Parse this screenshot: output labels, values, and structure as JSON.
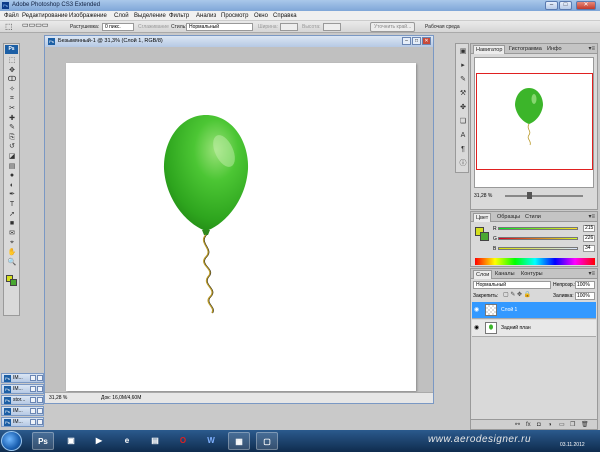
{
  "window": {
    "title": "Adobe Photoshop CS3 Extended",
    "min_glyph": "–",
    "max_glyph": "□",
    "close_glyph": "✕",
    "icon_label": "Ps"
  },
  "menu": [
    "Файл",
    "Редактирование",
    "Изображение",
    "Слой",
    "Выделение",
    "Фильтр",
    "Анализ",
    "Просмотр",
    "Окно",
    "Справка"
  ],
  "options_bar": {
    "feather_label": "Растушевка:",
    "feather_value": "0 пикс.",
    "antialias_label": "Сглаживание",
    "style_label": "Стиль:",
    "style_value": "Нормальный",
    "width_label": "Ширина:",
    "height_label": "Высота:",
    "refine_button": "Уточнить край...",
    "workspace_label": "Рабочая среда"
  },
  "toolbox": {
    "logo": "Ps",
    "tools": [
      "marquee-icon",
      "move-icon",
      "lasso-icon",
      "magic-wand-icon",
      "crop-icon",
      "slice-icon",
      "healing-icon",
      "brush-icon",
      "clone-stamp-icon",
      "history-brush-icon",
      "eraser-icon",
      "gradient-icon",
      "blur-icon",
      "dodge-icon",
      "pen-icon",
      "type-icon",
      "path-select-icon",
      "shape-icon",
      "notes-icon",
      "eyedropper-icon",
      "hand-icon",
      "zoom-icon"
    ],
    "glyphs": [
      "⬚",
      "✥",
      "ↀ",
      "✧",
      "⌗",
      "✂",
      "✚",
      "✎",
      "⎘",
      "↺",
      "◪",
      "▤",
      "●",
      "◐",
      "✒",
      "T",
      "➚",
      "■",
      "✉",
      "⌖",
      "✋",
      "🔍"
    ],
    "foreground_color": "#d4df1f",
    "background_color": "#4aa832"
  },
  "document": {
    "title": "Безымянный-1 @ 31,3% (Слой 1, RGB/8)",
    "zoom": "31,28 %",
    "doc_size": "Док: 16,0M/4,60M",
    "icon_label": "Ps"
  },
  "minimized_docs": [
    "IM...",
    "IM...",
    "stor...",
    "IM...",
    "IM..."
  ],
  "dock_icons": [
    "history-icon",
    "actions-icon",
    "brushes-icon",
    "tool-presets-icon",
    "clone-source-icon",
    "layer-comps-icon",
    "character-icon",
    "paragraph-icon",
    "info-icon"
  ],
  "dock_glyphs": [
    "▣",
    "▸",
    "✎",
    "⚒",
    "✤",
    "❏",
    "A",
    "¶",
    "ⓘ"
  ],
  "navigator": {
    "tabs": [
      "Навигатор",
      "Гистограмма",
      "Инфо"
    ],
    "zoom": "31,28 %",
    "menu_glyph": "▾≡"
  },
  "color_panel": {
    "tabs": [
      "Цвет",
      "Образцы",
      "Стили"
    ],
    "channels": [
      {
        "label": "R",
        "value": "215"
      },
      {
        "label": "G",
        "value": "226"
      },
      {
        "label": "B",
        "value": "34"
      }
    ],
    "foreground": "#d4df1f",
    "background": "#4aa832"
  },
  "layers_panel": {
    "tabs": [
      "Слои",
      "Каналы",
      "Контуры"
    ],
    "blend_mode": "Нормальный",
    "opacity_label": "Непрозр.:",
    "opacity_value": "100%",
    "lock_label": "Закрепить:",
    "fill_label": "Заливка:",
    "fill_value": "100%",
    "layers": [
      {
        "name": "Слой 1",
        "selected": true
      },
      {
        "name": "Задний план",
        "selected": false
      }
    ],
    "bottom_icons": [
      "link-icon",
      "fx-icon",
      "mask-icon",
      "adjustment-icon",
      "group-icon",
      "new-layer-icon",
      "trash-icon"
    ],
    "bottom_glyphs": [
      "⚯",
      "fx",
      "◘",
      "◑",
      "▭",
      "❐",
      "🗑"
    ]
  },
  "taskbar": {
    "items": [
      {
        "name": "taskbar-photoshop",
        "label": "Ps"
      },
      {
        "name": "taskbar-save",
        "label": "▣"
      },
      {
        "name": "taskbar-media",
        "label": "▶"
      },
      {
        "name": "taskbar-ie",
        "label": "e"
      },
      {
        "name": "taskbar-explorer",
        "label": "▤"
      },
      {
        "name": "taskbar-opera",
        "label": "O"
      },
      {
        "name": "taskbar-word",
        "label": "W"
      },
      {
        "name": "taskbar-network",
        "label": "▦"
      },
      {
        "name": "taskbar-folder",
        "label": "▢"
      }
    ],
    "watermark": "www.aerodesigner.ru",
    "date": "03.11.2012"
  }
}
